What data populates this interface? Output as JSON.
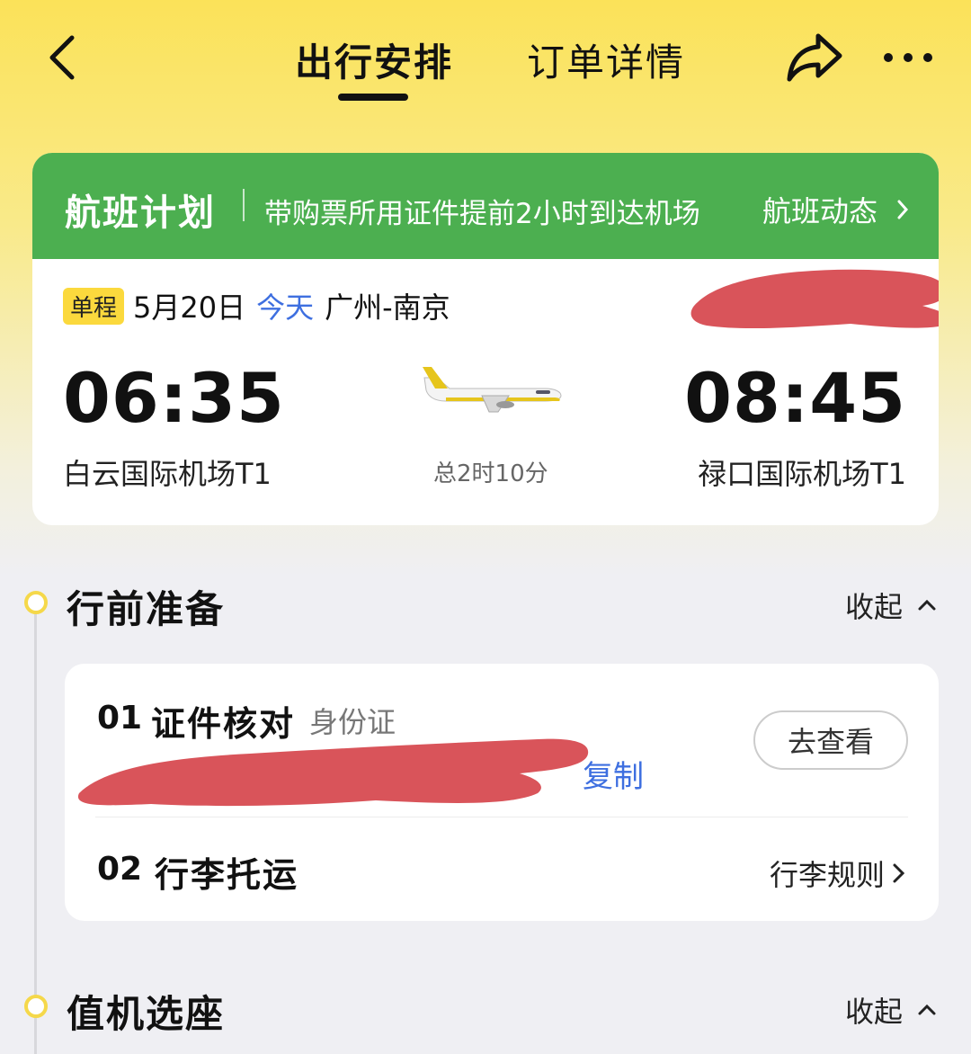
{
  "header": {
    "tabs": [
      {
        "label": "出行安排",
        "active": true
      },
      {
        "label": "订单详情",
        "active": false
      }
    ],
    "icons": [
      "back-icon",
      "share-icon",
      "more-icon"
    ]
  },
  "flight_card": {
    "header_title": "航班计划",
    "header_tip": "带购票所用证件提前2小时到达机场",
    "header_link": "航班动态",
    "trip_type": "单程",
    "date": "5月20日",
    "today": "今天",
    "route": "广州-南京",
    "departure_time": "06:35",
    "arrival_time": "08:45",
    "departure_airport": "白云国际机场T1",
    "arrival_airport": "禄口国际机场T1",
    "duration": "总2时10分"
  },
  "sections": [
    {
      "title": "行前准备",
      "toggle": "收起"
    },
    {
      "title": "值机选座",
      "toggle": "收起"
    }
  ],
  "prep": {
    "items": [
      {
        "num": "01",
        "name": "证件核对",
        "sub": "身份证",
        "copy": "复制",
        "action": "去查看"
      },
      {
        "num": "02",
        "name": "行李托运",
        "link": "行李规则"
      }
    ]
  },
  "colors": {
    "accent_yellow": "#fbd93d",
    "header_green": "#4caf50",
    "link_blue": "#3e6fe0",
    "redaction": "#d9545a"
  }
}
